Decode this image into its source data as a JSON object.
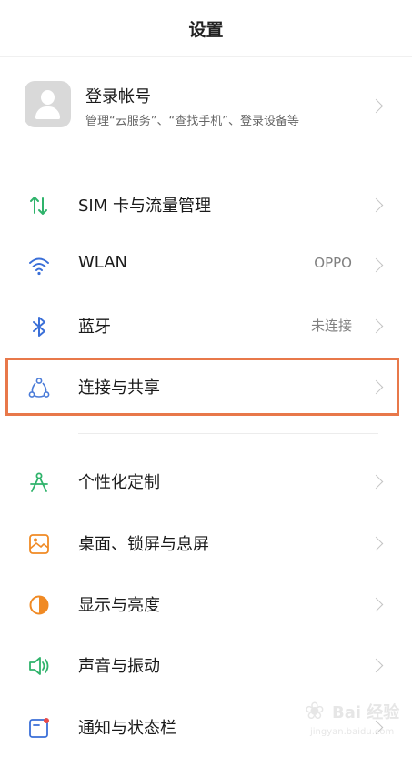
{
  "header": {
    "title": "设置"
  },
  "account": {
    "title": "登录帐号",
    "subtitle": "管理“云服务”、“查找手机”、登录设备等"
  },
  "rows": [
    {
      "label": "SIM 卡与流量管理",
      "value": "",
      "icon": "sim-data-icon"
    },
    {
      "label": "WLAN",
      "value": "OPPO",
      "icon": "wifi-icon"
    },
    {
      "label": "蓝牙",
      "value": "未连接",
      "icon": "bluetooth-icon"
    },
    {
      "label": "连接与共享",
      "value": "",
      "icon": "connection-share-icon"
    },
    {
      "label": "个性化定制",
      "value": "",
      "icon": "personalization-icon"
    },
    {
      "label": "桌面、锁屏与息屏",
      "value": "",
      "icon": "wallpaper-icon"
    },
    {
      "label": "显示与亮度",
      "value": "",
      "icon": "brightness-icon"
    },
    {
      "label": "声音与振动",
      "value": "",
      "icon": "sound-icon"
    },
    {
      "label": "通知与状态栏",
      "value": "",
      "icon": "notification-icon"
    }
  ],
  "colors": {
    "highlight": "#e8784a",
    "green_icon": "#2fb36b",
    "blue_icon": "#3a6fd8",
    "orange_icon": "#f08a24",
    "red_dot": "#e84a4a"
  },
  "watermark": {
    "text": "Bai 经验",
    "url": "jingyan.baidu.com"
  }
}
